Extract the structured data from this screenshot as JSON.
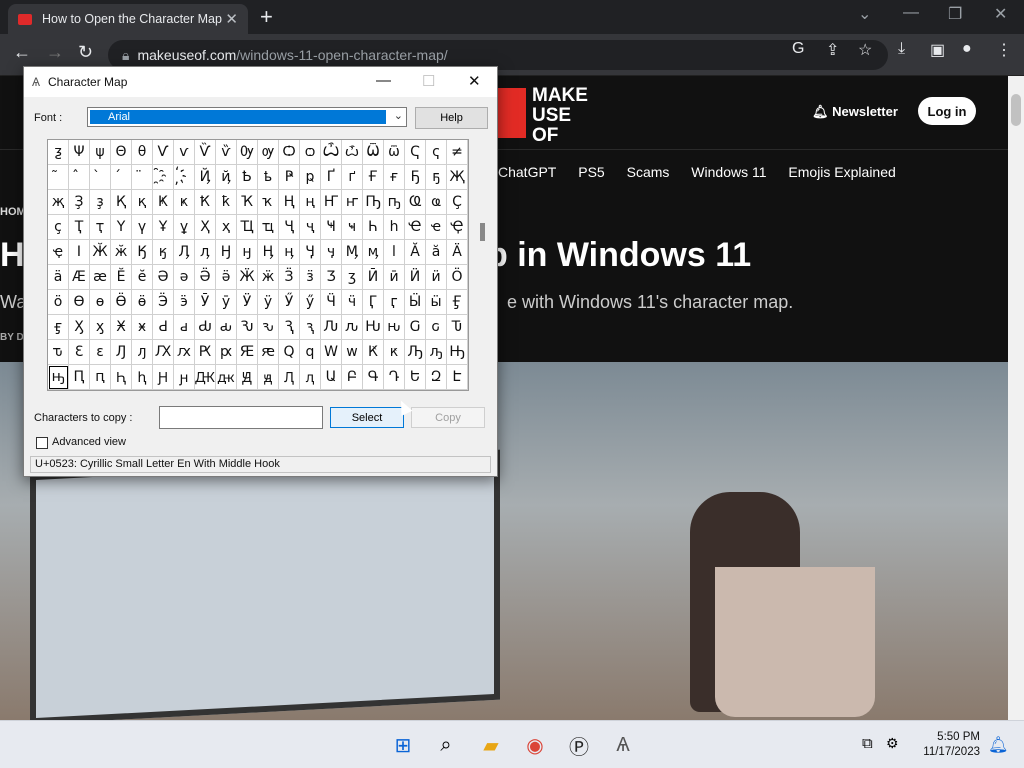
{
  "browser": {
    "tab_title": "How to Open the Character Map",
    "tab_close": "✕",
    "new_tab": "+",
    "url_host": "makeuseof.com",
    "url_path": "/windows-11-open-character-map/"
  },
  "site": {
    "logo_lines": [
      "MAKE",
      "USE",
      "OF"
    ],
    "newsletter": "Newsletter",
    "login": "Log in",
    "topics": [
      "ChatGPT",
      "PS5",
      "Scams",
      "Windows 11",
      "Emojis Explained"
    ],
    "crumb": "HOM",
    "headline_left": "H",
    "headline_right": "p in Windows 11",
    "subline_left": "Wa",
    "subline_right": "e with Windows 11's character map.",
    "byline": "BY D"
  },
  "charmap": {
    "title": "Character Map",
    "font_label": "Font :",
    "font_value": "Arial",
    "help": "Help",
    "grid": [
      [
        "ƺ",
        "Ψ",
        "ψ",
        "Θ",
        "θ",
        "Ѵ",
        "ѵ",
        "Ѷ",
        "ѷ",
        "Ѹ",
        "ѹ",
        "Ѻ",
        "ѻ",
        "Ѽ",
        "ѽ",
        "Ѿ",
        "ѿ",
        "Ҁ",
        "ҁ",
        "≠"
      ],
      [
        "̃",
        "̂",
        "̀",
        "́",
        "̈",
        "҈",
        "҉",
        "Ҋ",
        "ҋ",
        "Ҍ",
        "ҍ",
        "Ҏ",
        "ҏ",
        "Ґ",
        "ґ",
        "Ғ",
        "ғ",
        "Ҕ",
        "ҕ",
        "Җ"
      ],
      [
        "җ",
        "Ҙ",
        "ҙ",
        "Қ",
        "қ",
        "Ҝ",
        "ҝ",
        "Ҟ",
        "ҟ",
        "Ҡ",
        "ҡ",
        "Ң",
        "ң",
        "Ҥ",
        "ҥ",
        "Ҧ",
        "ҧ",
        "Ҩ",
        "ҩ",
        "Ҫ"
      ],
      [
        "ҫ",
        "Ҭ",
        "ҭ",
        "Ү",
        "ү",
        "Ұ",
        "ұ",
        "Ҳ",
        "ҳ",
        "Ҵ",
        "ҵ",
        "Ҷ",
        "ҷ",
        "Ҹ",
        "ҹ",
        "Һ",
        "һ",
        "Ҽ",
        "ҽ",
        "Ҿ"
      ],
      [
        "ҿ",
        "Ӏ",
        "Ӂ",
        "ӂ",
        "Ӄ",
        "ӄ",
        "Ӆ",
        "ӆ",
        "Ӈ",
        "ӈ",
        "Ӊ",
        "ӊ",
        "Ӌ",
        "ӌ",
        "Ӎ",
        "ӎ",
        "ӏ",
        "Ӑ",
        "ӑ",
        "Ӓ"
      ],
      [
        "ӓ",
        "Ӕ",
        "ӕ",
        "Ӗ",
        "ӗ",
        "Ә",
        "ә",
        "Ӛ",
        "ӛ",
        "Ӝ",
        "ӝ",
        "Ӟ",
        "ӟ",
        "Ӡ",
        "ӡ",
        "Ӣ",
        "ӣ",
        "Ӥ",
        "ӥ",
        "Ӧ"
      ],
      [
        "ӧ",
        "Ө",
        "ө",
        "Ӫ",
        "ӫ",
        "Ӭ",
        "ӭ",
        "Ӯ",
        "ӯ",
        "Ӱ",
        "ӱ",
        "Ӳ",
        "ӳ",
        "Ӵ",
        "ӵ",
        "Ӷ",
        "ӷ",
        "Ӹ",
        "ӹ",
        "Ӻ"
      ],
      [
        "ӻ",
        "Ӽ",
        "ӽ",
        "Ӿ",
        "ӿ",
        "Ԁ",
        "ԁ",
        "Ԃ",
        "ԃ",
        "Ԅ",
        "ԅ",
        "Ԇ",
        "ԇ",
        "Ԉ",
        "ԉ",
        "Ԋ",
        "ԋ",
        "Ԍ",
        "ԍ",
        "Ԏ"
      ],
      [
        "ԏ",
        "Ԑ",
        "ԑ",
        "Ԓ",
        "ԓ",
        "Ԕ",
        "ԕ",
        "Ԗ",
        "ԗ",
        "Ԙ",
        "ԙ",
        "Ԛ",
        "ԛ",
        "Ԝ",
        "ԝ",
        "Ԟ",
        "ԟ",
        "Ԡ",
        "ԡ",
        "Ԣ"
      ],
      [
        "ԣ",
        "Ԥ",
        "ԥ",
        "Ԧ",
        "ԧ",
        "Ԩ",
        "ԩ",
        "Ԫ",
        "ԫ",
        "Ԭ",
        "ԭ",
        "Ԯ",
        "ԯ",
        "Ա",
        "Բ",
        "Գ",
        "Դ",
        "Ե",
        "Զ",
        "Է"
      ]
    ],
    "selected_row": 9,
    "selected_col": 0,
    "chars_to_copy_label": "Characters to copy :",
    "chars_to_copy_value": "",
    "select": "Select",
    "copy": "Copy",
    "advanced_view": "Advanced view",
    "status": "U+0523: Cyrillic Small Letter En With Middle Hook"
  },
  "taskbar": {
    "time": "5:50 PM",
    "date": "11/17/2023",
    "icons": [
      "windows-start-icon",
      "search-icon",
      "file-explorer-icon",
      "chrome-icon",
      "p-app-icon",
      "character-map-icon"
    ]
  }
}
